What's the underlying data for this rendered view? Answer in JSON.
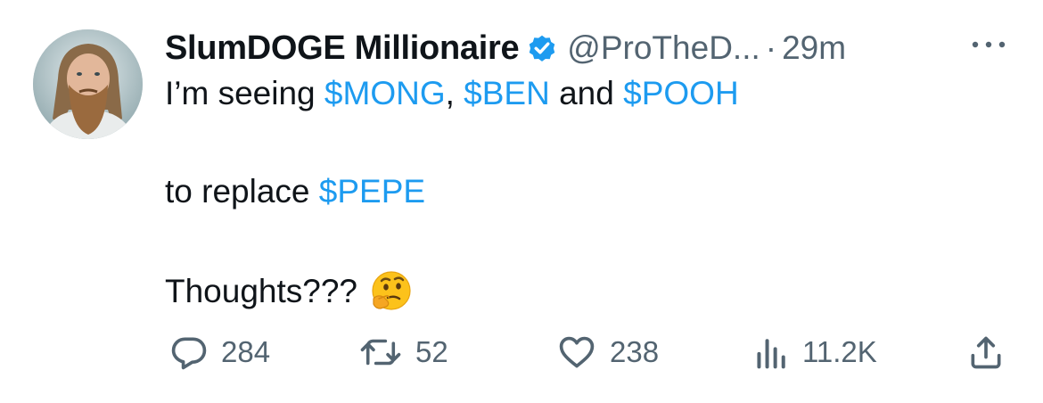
{
  "tweet": {
    "author_name": "SlumDOGE Millionaire",
    "handle": "@ProTheD...",
    "separator": "·",
    "time": "29m",
    "line1": {
      "prefix": "I’m seeing ",
      "tag1": "$MONG",
      "sep1": ", ",
      "tag2": "$BEN",
      "sep2": " and ",
      "tag3": "$POOH"
    },
    "line2": {
      "prefix": "to replace ",
      "tag": "$PEPE"
    },
    "line3": {
      "text": "Thoughts???"
    },
    "emoji": "thinking-face-emoji"
  },
  "actions": {
    "replies": "284",
    "retweets": "52",
    "likes": "238",
    "views": "11.2K"
  },
  "icons": {
    "verified": "verified-badge-icon",
    "more": "more-options-icon",
    "reply": "reply-icon",
    "retweet": "retweet-icon",
    "like": "heart-icon",
    "views": "views-icon",
    "share": "share-icon"
  },
  "colors": {
    "text": "#0f1419",
    "muted": "#536471",
    "link": "#1d9bf0",
    "verified": "#1d9bf0"
  }
}
